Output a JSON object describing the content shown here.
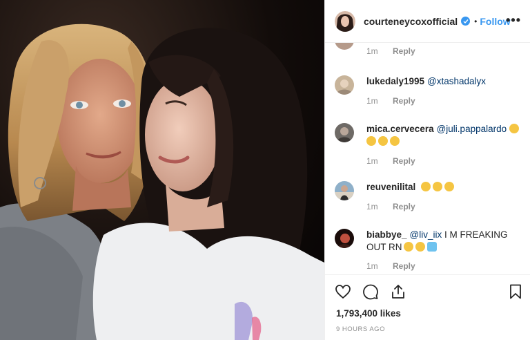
{
  "header": {
    "username": "courteneycoxofficial",
    "dot": "•",
    "follow_label": "Follow",
    "more_label": "•••"
  },
  "comments": [
    {
      "username": "",
      "mention": "",
      "text": "",
      "time": "1m",
      "reply": "Reply",
      "avatar_color": "#b59a8a"
    },
    {
      "username": "lukedaly1995",
      "mention": "@xtashadalyx",
      "text": "",
      "time": "1m",
      "reply": "Reply",
      "avatar_color": "#c8b49a"
    },
    {
      "username": "mica.cervecera",
      "mention": "@juli.pappalardo",
      "text": "",
      "time": "1m",
      "reply": "Reply",
      "avatar_color": "#6e6a66",
      "emoji_count_line1": 1,
      "emoji_count_line2": 3
    },
    {
      "username": "reuvenilital",
      "mention": "",
      "text": "",
      "time": "1m",
      "reply": "Reply",
      "avatar_color": "#8fb0c9",
      "emoji_count_line1": 3
    },
    {
      "username": "biabbye_",
      "mention": "@liv_iix",
      "text": "I M FREAKING OUT RN",
      "time": "1m",
      "reply": "Reply",
      "avatar_color": "#3a1a14"
    }
  ],
  "actions": {
    "likes": "1,793,400 likes",
    "ago": "9 HOURS AGO",
    "icons": [
      "heart-icon",
      "comment-icon",
      "share-icon",
      "bookmark-icon"
    ]
  },
  "colors": {
    "accent": "#3897f0",
    "muted": "#8e8e8e",
    "border": "#efefef"
  }
}
